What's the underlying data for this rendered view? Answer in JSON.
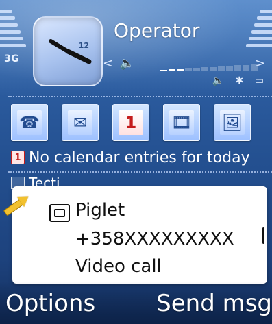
{
  "status": {
    "network_label": "3G",
    "operator": "Operator",
    "volume": {
      "left_arrow": "<",
      "right_arrow": ">",
      "speaker_icon": "speaker-icon",
      "level_fraction": 0.25,
      "right_edge": "0"
    },
    "indicators": [
      "speaker-icon",
      "bluetooth-icon",
      "battery-icon"
    ],
    "colors": {
      "background": "#234f8f",
      "highlight": "#ffffff",
      "calendar_red": "#c41b1b",
      "pointer_yellow": "#f2c12e"
    }
  },
  "shortcuts": [
    {
      "name": "phone-shortcut",
      "icon": "phone-icon"
    },
    {
      "name": "messages-shortcut",
      "icon": "envelope-icon"
    },
    {
      "name": "calendar-shortcut",
      "icon": "calendar-icon"
    },
    {
      "name": "media-shortcut",
      "icon": "film-icon"
    },
    {
      "name": "gallery-shortcut",
      "icon": "photo-icon"
    }
  ],
  "calendar": {
    "icon_text": "1",
    "text": "No calendar entries for today"
  },
  "todo": {
    "text": "Tecti"
  },
  "popup": {
    "name": "Piglet",
    "number": "+358XXXXXXXXX",
    "action": "Video call"
  },
  "softkeys": {
    "left": "Options",
    "right": "Send msg"
  }
}
